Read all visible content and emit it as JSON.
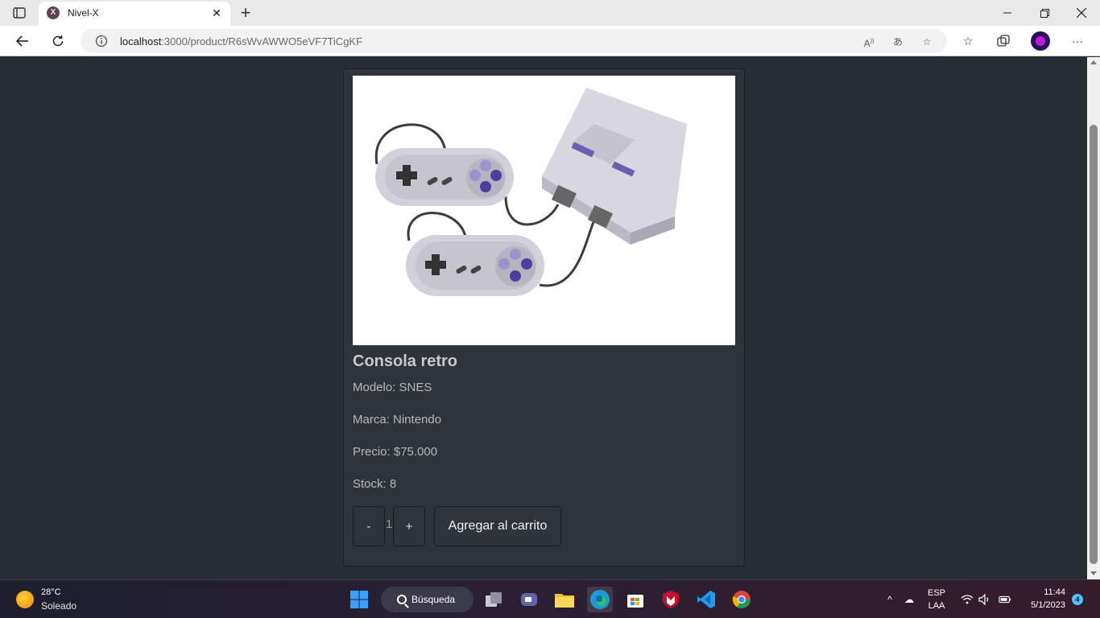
{
  "browser": {
    "tab_title": "Nivel-X",
    "favicon_letter": "X",
    "url_host": "localhost",
    "url_path": ":3000/product/R6sWvAWWO5eVF7TiCgKF"
  },
  "product": {
    "title": "Consola retro",
    "specs": [
      {
        "label": "Modelo:",
        "value": "SNES"
      },
      {
        "label": "Marca:",
        "value": "Nintendo"
      },
      {
        "label": "Precio:",
        "value": "$75.000"
      },
      {
        "label": "Stock:",
        "value": "8"
      }
    ],
    "quantity": "1",
    "decrement_label": "-",
    "increment_label": "+",
    "add_to_cart_label": "Agregar al carrito"
  },
  "taskbar": {
    "weather_temp": "28°C",
    "weather_desc": "Soleado",
    "search_label": "Búsqueda",
    "language": "ESP",
    "layout": "LAA",
    "time": "11:44",
    "date": "5/1/2023",
    "notifications": "4"
  }
}
